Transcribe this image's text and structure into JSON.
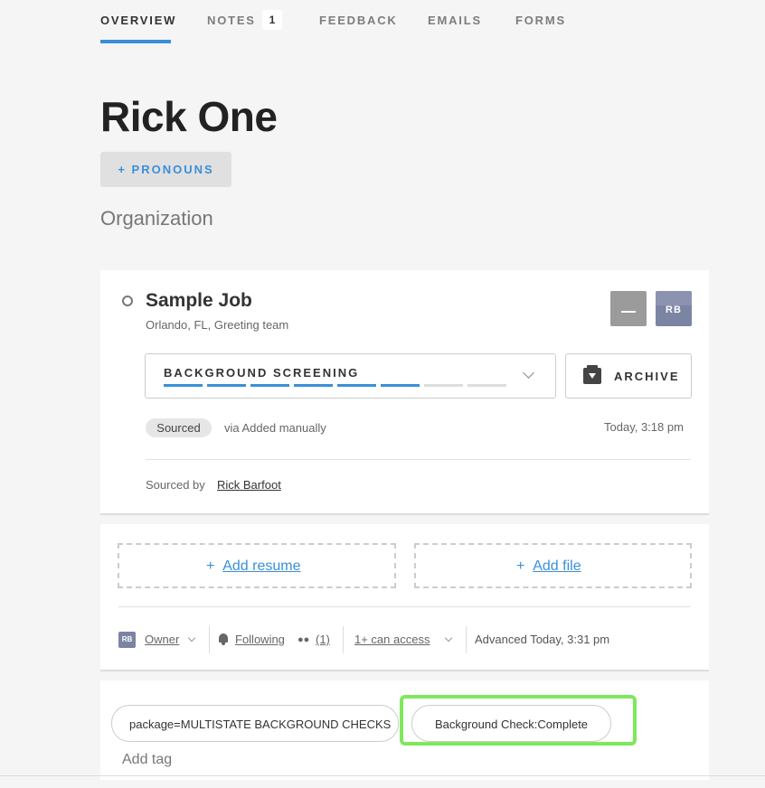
{
  "tabs": [
    {
      "label": "OVERVIEW",
      "active": true
    },
    {
      "label": "NOTES",
      "badge": "1"
    },
    {
      "label": "FEEDBACK"
    },
    {
      "label": "EMAILS"
    },
    {
      "label": "FORMS"
    }
  ],
  "candidate": {
    "name": "Rick One",
    "pronouns_button": "+ PRONOUNS",
    "organization": "Organization"
  },
  "job": {
    "title": "Sample Job",
    "subtitle": "Orlando, FL, Greeting team",
    "avatar_initials": "RB",
    "stage": "BACKGROUND SCREENING",
    "stage_progress": {
      "completed": 6,
      "total": 8
    },
    "archive_label": "ARCHIVE",
    "source_tag": "Sourced",
    "source_via": "via Added manually",
    "timestamp": "Today, 3:18 pm",
    "sourced_by_label": "Sourced by",
    "sourced_by_name": "Rick Barfoot"
  },
  "files": {
    "add_resume": "Add resume",
    "add_file": "Add file",
    "plus": "+"
  },
  "meta": {
    "owner_initials": "RB",
    "owner": "Owner",
    "following": "Following",
    "followers_count": "(1)",
    "access": "1+ can access",
    "advanced": "Advanced Today, 3:31 pm"
  },
  "tags": {
    "items": [
      "package=MULTISTATE BACKGROUND CHECKS",
      "Background Check:Complete"
    ],
    "add_tag": "Add tag"
  },
  "colors": {
    "accent": "#3a8fd8",
    "highlight": "#7ee85b",
    "avatar": "#7b84a3"
  }
}
